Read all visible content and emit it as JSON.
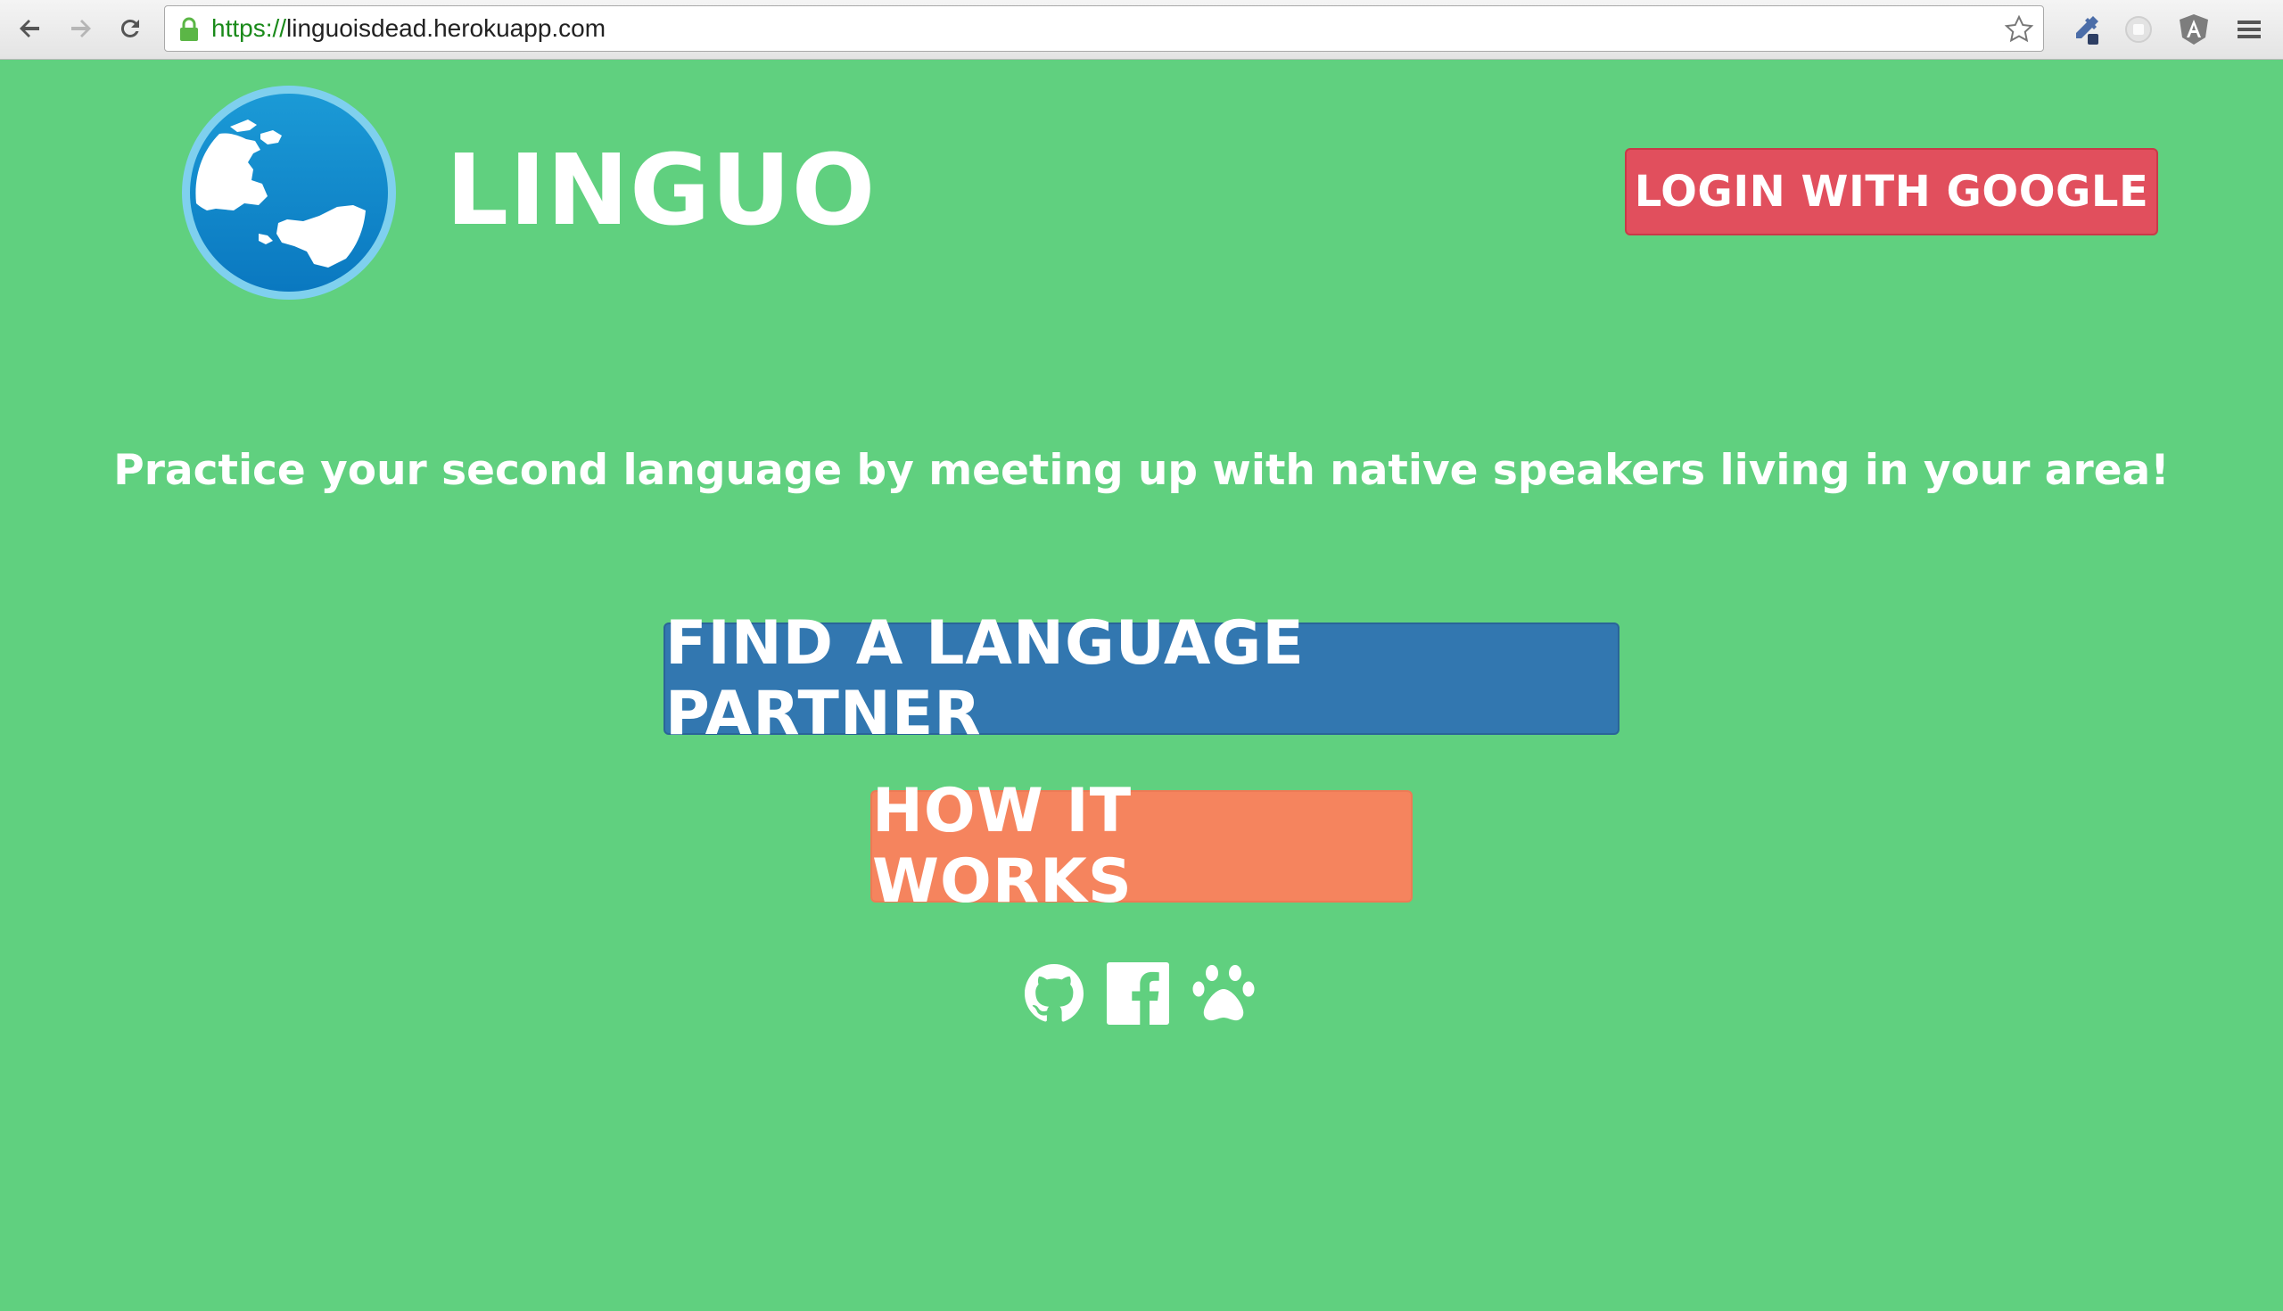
{
  "browser": {
    "url_scheme": "https://",
    "url_host": "linguoisdead.herokuapp.com",
    "icons": [
      "back-icon",
      "forward-icon",
      "reload-icon",
      "lock-icon",
      "bookmark-star-icon",
      "eyedropper-extension-icon",
      "adblock-extension-icon",
      "angular-extension-icon",
      "menu-icon"
    ]
  },
  "header": {
    "brand": "LINGUO",
    "login_label": "LOGIN WITH GOOGLE"
  },
  "main": {
    "tagline": "Practice your second language by meeting up with native speakers living in your area!",
    "find_partner_label": "FIND A LANGUAGE PARTNER",
    "how_it_works_label": "HOW IT WORKS"
  },
  "social": [
    "github-icon",
    "facebook-icon",
    "paw-icon"
  ],
  "colors": {
    "background": "#60d07f",
    "login": "#e14f5d",
    "find": "#3277b0",
    "how": "#f5845e"
  }
}
